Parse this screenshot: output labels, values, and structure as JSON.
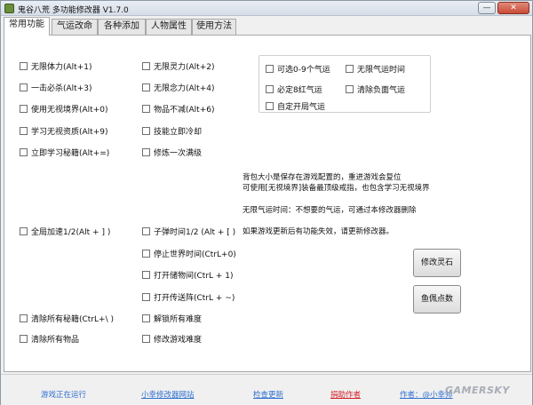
{
  "window": {
    "title": "鬼谷八荒 多功能修改器  V1.7.0",
    "close_label": "✕",
    "min_label": "—"
  },
  "tabs": [
    {
      "label": "常用功能",
      "active": true
    },
    {
      "label": "气运改命",
      "active": false
    },
    {
      "label": "各种添加",
      "active": false
    },
    {
      "label": "人物属性",
      "active": false
    },
    {
      "label": "使用方法",
      "active": false
    }
  ],
  "left_col": [
    "无限体力(Alt+1)",
    "一击必杀(Alt+3)",
    "使用无视境界(Alt+0)",
    "学习无视资质(Alt+9)",
    "立即学习秘籍(Alt+=)"
  ],
  "mid_col": [
    "无限灵力(Alt+2)",
    "无限念力(Alt+4)",
    "物品不减(Alt+6)",
    "技能立即冷却",
    "修炼一次满级"
  ],
  "luck_group": [
    "可选0-9个气运",
    "无限气运时间",
    "必定8红气运",
    "清除负面气运",
    "自定开局气运"
  ],
  "notes": [
    "背包大小是保存在游戏配置的，重进游戏会复位",
    "可使用[无视境界]装备最顶级戒指，也包含学习无视境界",
    "无限气运时间：不想要的气运，可通过本修改器删除",
    "如果游戏更新后有功能失效，请更新修改器。"
  ],
  "lower_left": [
    "全局加速1/2(Alt + ] )",
    "清除所有秘籍(CtrL+\\ )",
    "清除所有物品"
  ],
  "lower_mid": [
    "子弹时间1/2 (Alt + [ )",
    "停止世界时间(CtrL+0)",
    "打开储物间(CtrL + 1)",
    "打开传送阵(CtrL + ~)",
    "解锁所有难度",
    "修改游戏难度"
  ],
  "buttons": {
    "modify_stone": "修改灵石",
    "modify_points": "鱼佩点数"
  },
  "footer": {
    "status": "游戏正在运行",
    "site": "小幸修改器网站",
    "update": "检查更新",
    "donate": "捐助作者",
    "author": "作者：@小幸帅"
  },
  "watermark": "GAMERSKY",
  "colors": {
    "link_blue": "#2e6fcf",
    "donate_red": "#d4202a"
  }
}
